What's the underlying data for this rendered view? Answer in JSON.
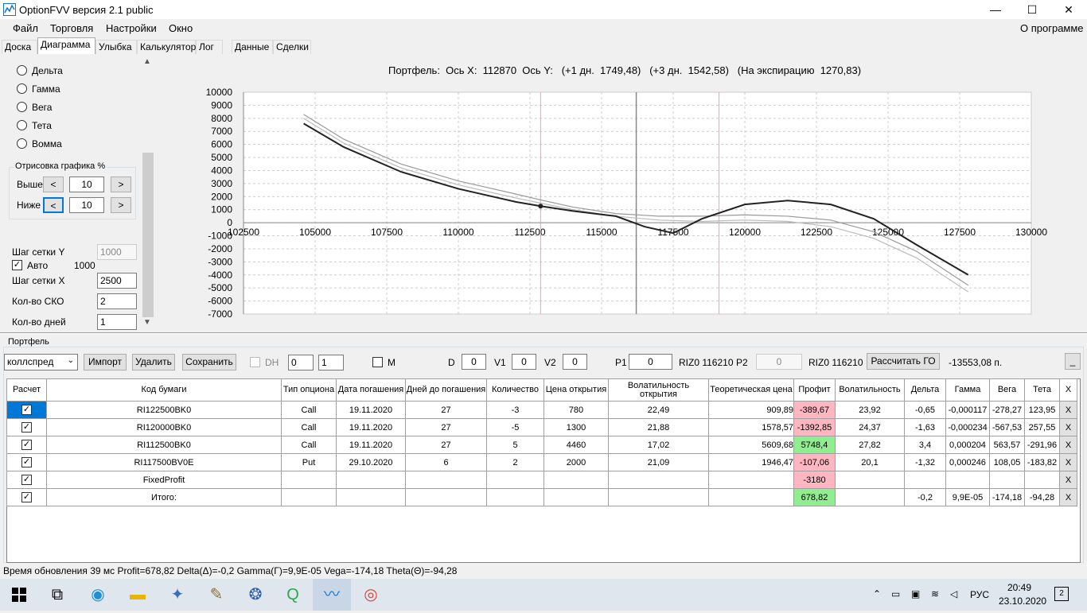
{
  "window": {
    "title": "OptionFVV версия 2.1 public",
    "minimize": "—",
    "maximize": "☐",
    "close": "✕"
  },
  "menu": [
    "Файл",
    "Торговля",
    "Настройки",
    "Окно"
  ],
  "menu_right": "О программе",
  "tabs": [
    "Доска",
    "Диаграмма",
    "Улыбка",
    "Калькулятор",
    "Лог",
    "Данные",
    "Сделки"
  ],
  "left": {
    "radios": [
      "Дельта",
      "Гамма",
      "Вега",
      "Тета",
      "Вомма"
    ],
    "draw_group": "Отрисовка графика %",
    "above_label": "Выше",
    "above_value": "10",
    "below_label": "Ниже",
    "below_value": "10",
    "btn_left": "<",
    "btn_right": ">",
    "grid_y_label": "Шаг сетки Y",
    "grid_y_value": "1000",
    "auto_label": "Авто",
    "auto_value": "1000",
    "grid_x_label": "Шаг сетки X",
    "grid_x_value": "2500",
    "sko_label": "Кол-во СКО",
    "sko_value": "2",
    "days_label": "Кол-во дней",
    "days_value": "1"
  },
  "chart_header": "Портфель:  Ось X:  112870  Ось Y:   (+1 дн.  1749,48)   (+3 дн.  1542,58)   (На экспирацию  1270,83)",
  "chart_data": {
    "type": "line",
    "xlim": [
      102500,
      130000
    ],
    "ylim": [
      -7000,
      10000
    ],
    "xticks": [
      "102500",
      "105000",
      "107500",
      "110000",
      "112500",
      "115000",
      "117500",
      "120000",
      "122500",
      "125000",
      "127500",
      "130000"
    ],
    "yticks": [
      "10000",
      "9000",
      "8000",
      "7000",
      "6000",
      "5000",
      "4000",
      "3000",
      "2000",
      "1000",
      "0",
      "-1000",
      "-2000",
      "-3000",
      "-4000",
      "-5000",
      "-6000",
      "-7000"
    ],
    "vlines_red": [
      112870,
      119100
    ],
    "vline_gray": 116210,
    "marker": {
      "x": 112870,
      "y": 1270
    },
    "series": [
      {
        "color": "#222222",
        "x": [
          104600,
          106000,
          108000,
          110000,
          112000,
          112870,
          114000,
          115500,
          116500,
          117500,
          118500,
          120000,
          121500,
          123000,
          124500,
          126000,
          127800
        ],
        "y": [
          7600,
          5800,
          3900,
          2600,
          1600,
          1270,
          900,
          500,
          -300,
          -800,
          300,
          1400,
          1700,
          1400,
          300,
          -1700,
          -4000
        ]
      },
      {
        "color": "#999999",
        "x": [
          104600,
          106000,
          108000,
          110000,
          112000,
          112870,
          114000,
          115500,
          117000,
          118500,
          120000,
          121500,
          123000,
          124500,
          126000,
          127800
        ],
        "y": [
          8300,
          6400,
          4500,
          3200,
          2200,
          1750,
          1200,
          700,
          500,
          500,
          600,
          500,
          200,
          -700,
          -2200,
          -4800
        ]
      },
      {
        "color": "#bbbbbb",
        "x": [
          104600,
          106000,
          108000,
          110000,
          112000,
          112870,
          114000,
          115500,
          117000,
          118500,
          120000,
          121500,
          123000,
          124500,
          126000,
          127800
        ],
        "y": [
          8000,
          6100,
          4200,
          2900,
          1900,
          1500,
          1000,
          500,
          200,
          100,
          200,
          100,
          -300,
          -1200,
          -2700,
          -5300
        ]
      }
    ]
  },
  "portfolio": {
    "group_label": "Портфель",
    "combo": "коллспред",
    "import": "Импорт",
    "delete": "Удалить",
    "save": "Сохранить",
    "dh": "DH",
    "spin1": "0",
    "spin2": "1",
    "m": "M",
    "d_label": "D",
    "d_value": "0",
    "v1_label": "V1",
    "v1_value": "0",
    "v2_label": "V2",
    "v2_value": "0",
    "p1_label": "P1",
    "p1_value": "0",
    "riz1": "RIZ0 116210",
    "p2_label": "P2",
    "p2_value": "0",
    "riz2": "RIZ0 116210",
    "calc_go": "Рассчитать ГО",
    "go_value": "-13553,08 п.",
    "min_btn": "_"
  },
  "table": {
    "headers": [
      "Расчет",
      "Код бумаги",
      "Тип опциона",
      "Дата погашения",
      "Дней до погашения",
      "Количество",
      "Цена открытия",
      "Волатильность открытия",
      "Теоретическая цена",
      "Профит",
      "Волатильность",
      "Дельта",
      "Гамма",
      "Вега",
      "Тета",
      "X"
    ],
    "rows": [
      {
        "code": "RI122500BK0",
        "type": "Call",
        "date": "19.11.2020",
        "days": "27",
        "qty": "-3",
        "price": "780",
        "vol_open": "22,49",
        "theo": "909,89",
        "profit": "-389,67",
        "pc": "neg",
        "vol": "23,92",
        "delta": "-0,65",
        "gamma": "-0,000117",
        "vega": "-278,27",
        "theta": "123,95",
        "x": "X"
      },
      {
        "code": "RI120000BK0",
        "type": "Call",
        "date": "19.11.2020",
        "days": "27",
        "qty": "-5",
        "price": "1300",
        "vol_open": "21,88",
        "theo": "1578,57",
        "profit": "-1392,85",
        "pc": "neg",
        "vol": "24,37",
        "delta": "-1,63",
        "gamma": "-0,000234",
        "vega": "-567,53",
        "theta": "257,55",
        "x": "X"
      },
      {
        "code": "RI112500BK0",
        "type": "Call",
        "date": "19.11.2020",
        "days": "27",
        "qty": "5",
        "price": "4460",
        "vol_open": "17,02",
        "theo": "5609,68",
        "profit": "5748,4",
        "pc": "pos",
        "vol": "27,82",
        "delta": "3,4",
        "gamma": "0,000204",
        "vega": "563,57",
        "theta": "-291,96",
        "x": "X"
      },
      {
        "code": "RI117500BV0E",
        "type": "Put",
        "date": "29.10.2020",
        "days": "6",
        "qty": "2",
        "price": "2000",
        "vol_open": "21,09",
        "theo": "1946,47",
        "profit": "-107,06",
        "pc": "neg",
        "vol": "20,1",
        "delta": "-1,32",
        "gamma": "0,000246",
        "vega": "108,05",
        "theta": "-183,82",
        "x": "X"
      },
      {
        "code": "FixedProfit",
        "type": "",
        "date": "",
        "days": "",
        "qty": "",
        "price": "",
        "vol_open": "",
        "theo": "",
        "profit": "-3180",
        "pc": "neg",
        "vol": "",
        "delta": "",
        "gamma": "",
        "vega": "",
        "theta": "",
        "x": "X"
      },
      {
        "code": "Итого:",
        "type": "",
        "date": "",
        "days": "",
        "qty": "",
        "price": "",
        "vol_open": "",
        "theo": "",
        "profit": "678,82",
        "pc": "pos",
        "vol": "",
        "delta": "-0,2",
        "gamma": "9,9E-05",
        "vega": "-174,18",
        "theta": "-94,28",
        "x": "X"
      }
    ]
  },
  "status": "Время обновления 39 мс   Profit=678,82 Delta(Δ)=-0,2 Gamma(Γ)=9,9E-05 Vega=-174,18 Theta(Θ)=-94,28",
  "taskbar": {
    "time": "20:49",
    "date": "23.10.2020",
    "lang": "РУС",
    "notif": "2"
  }
}
